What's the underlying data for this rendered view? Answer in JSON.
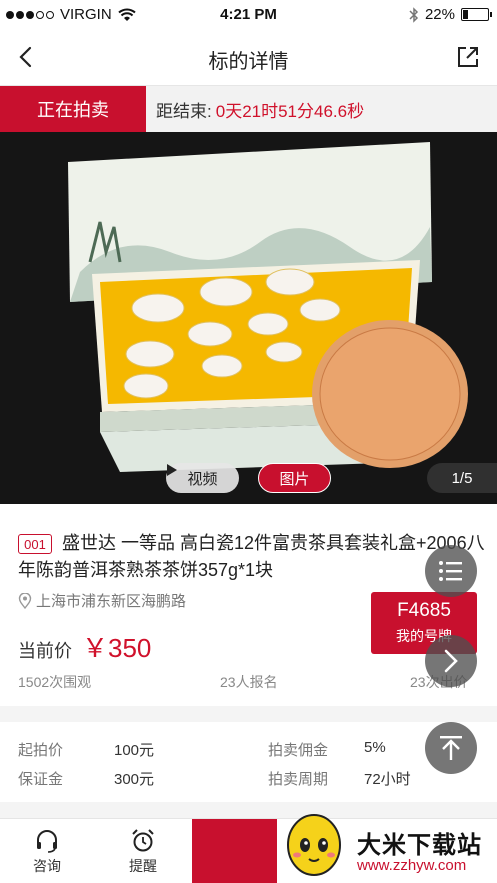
{
  "status": {
    "carrier": "VIRGIN",
    "time": "4:21 PM",
    "battery": "22%"
  },
  "nav": {
    "title": "标的详情",
    "back_icon": "chevron-left-icon",
    "share_icon": "share-icon"
  },
  "auction": {
    "status_label": "正在拍卖",
    "countdown_label": "距结束:",
    "countdown_value": "0天21时51分46.6秒"
  },
  "hero": {
    "video_label": "视频",
    "picture_label": "图片",
    "counter": "1/5"
  },
  "item": {
    "lot": "001",
    "title": "盛世达 一等品 高白瓷12件富贵茶具套装礼盒+2006八年陈韵普洱茶熟茶茶饼357g*1块",
    "location": "上海市浦东新区海鹏路",
    "price_label": "当前价",
    "price": "￥350",
    "paddle_number": "F4685",
    "paddle_label": "我的号牌",
    "views": "1502次围观",
    "registrations": "23人报名",
    "bids": "23次出价"
  },
  "fees": {
    "start_price_label": "起拍价",
    "start_price": "100元",
    "commission_label": "拍卖佣金",
    "commission": "5%",
    "deposit_label": "保证金",
    "deposit": "300元",
    "period_label": "拍卖周期",
    "period": "72小时"
  },
  "toolbar": {
    "consult": "咨询",
    "remind": "提醒"
  },
  "watermark": {
    "name": "大米下载站",
    "url": "www.zzhyw.com"
  },
  "colors": {
    "accent": "#c8102e",
    "price": "#d0112b"
  }
}
